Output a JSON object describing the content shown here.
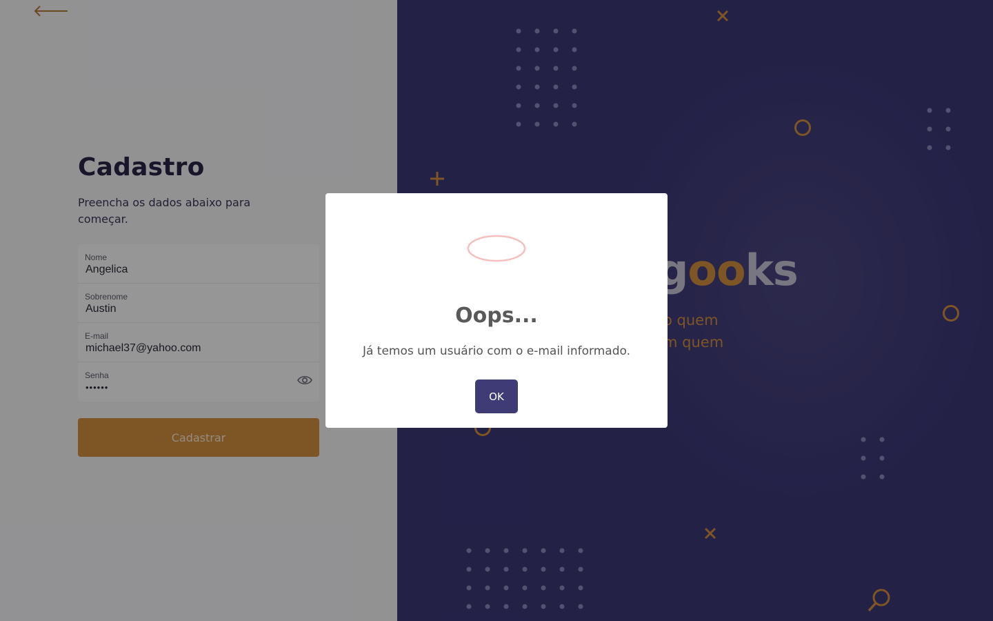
{
  "colors": {
    "brand_purple": "#3b3776",
    "accent_orange": "#d28e3d",
    "dark_text": "#2a2647",
    "modal_button": "#3f3b76"
  },
  "nav": {
    "back_icon": "arrow-left-icon"
  },
  "signup": {
    "title": "Cadastro",
    "subtitle": "Preencha os dados abaixo para começar.",
    "fields": {
      "first_name": {
        "label": "Nome",
        "value": "Angelica"
      },
      "last_name": {
        "label": "Sobrenome",
        "value": "Austin"
      },
      "email": {
        "label": "E-mail",
        "value": "michael37@yahoo.com"
      },
      "password": {
        "label": "Senha",
        "value": "••••••",
        "toggle_icon": "eye-icon"
      }
    },
    "submit_label": "Cadastrar"
  },
  "hero": {
    "brand_prefix": "g",
    "brand_suffix": "ks",
    "tagline_line1": "o quem",
    "tagline_line2": "m quem"
  },
  "modal": {
    "icon": "error-circle-icon",
    "title": "Oops...",
    "message": "Já temos um usuário com o e-mail informado.",
    "ok_label": "OK"
  }
}
